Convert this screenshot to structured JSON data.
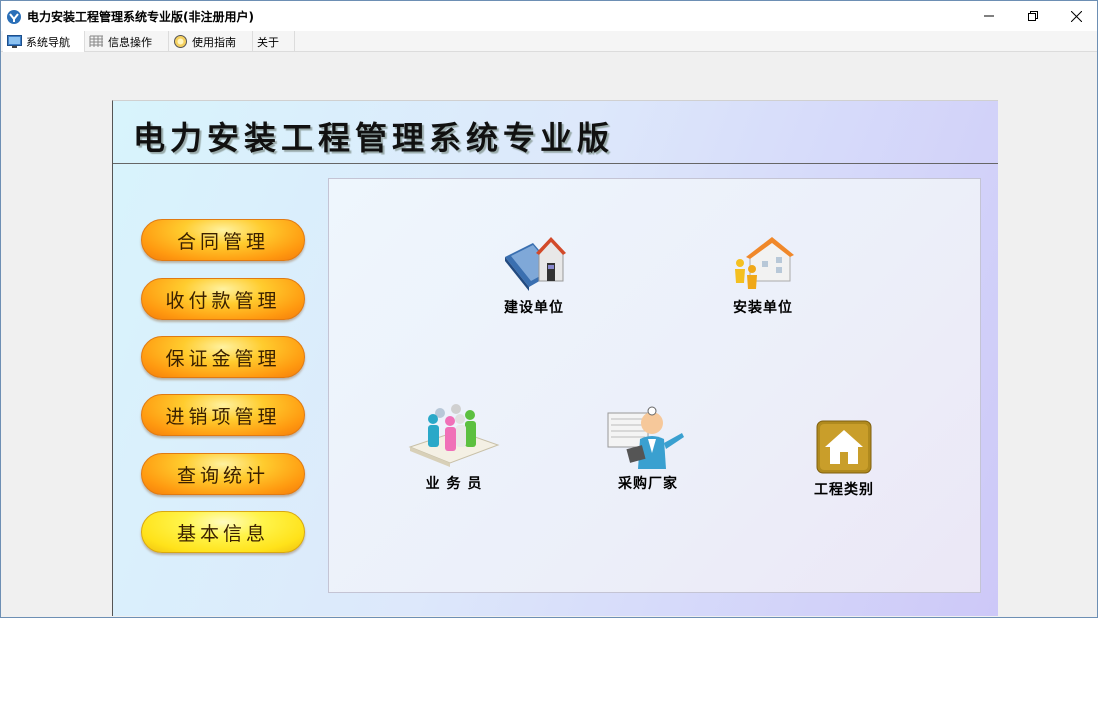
{
  "window": {
    "title": "电力安装工程管理系统专业版(非注册用户)"
  },
  "menu": {
    "tabs": [
      {
        "label": "系统导航",
        "icon": "monitor-icon"
      },
      {
        "label": "信息操作",
        "icon": "grid-icon"
      },
      {
        "label": "使用指南",
        "icon": "guide-icon"
      },
      {
        "label": "关于",
        "icon": ""
      }
    ]
  },
  "panel": {
    "title": "电力安装工程管理系统专业版"
  },
  "nav": {
    "buttons": [
      {
        "label": "合同管理"
      },
      {
        "label": "收付款管理"
      },
      {
        "label": "保证金管理"
      },
      {
        "label": "进销项管理"
      },
      {
        "label": "查询统计"
      },
      {
        "label": "基本信息"
      }
    ]
  },
  "tiles": [
    {
      "label": "建设单位",
      "icon": "book-house-icon"
    },
    {
      "label": "安装单位",
      "icon": "building-people-icon"
    },
    {
      "label": "业 务 员",
      "icon": "people-group-icon"
    },
    {
      "label": "采购厂家",
      "icon": "doctor-presentation-icon"
    },
    {
      "label": "工程类别",
      "icon": "house-icon"
    }
  ],
  "colors": {
    "nav_orange": "#ff9a10",
    "nav_yellow": "#ffe21a",
    "panel_gradient_start": "#d8f4fc",
    "panel_gradient_end": "#cdc8f8"
  }
}
